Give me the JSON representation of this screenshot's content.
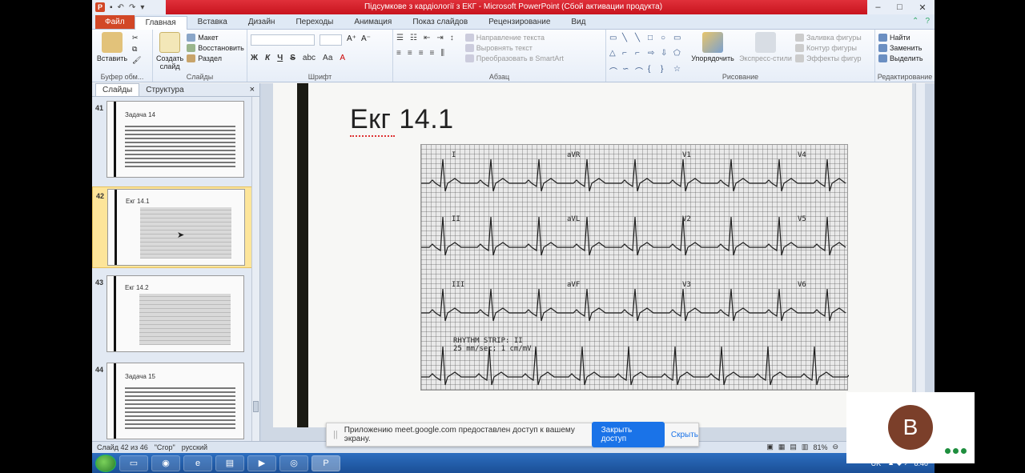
{
  "window": {
    "title": "Підсумкове з кардіології з ЕКГ  -  Microsoft PowerPoint (Сбой активации продукта)",
    "qa_icon": "P"
  },
  "tabs": [
    {
      "label": "Файл"
    },
    {
      "label": "Главная"
    },
    {
      "label": "Вставка"
    },
    {
      "label": "Дизайн"
    },
    {
      "label": "Переходы"
    },
    {
      "label": "Анимация"
    },
    {
      "label": "Показ слайдов"
    },
    {
      "label": "Рецензирование"
    },
    {
      "label": "Вид"
    }
  ],
  "ribbon": {
    "clipboard": {
      "paste": "Вставить",
      "label": "Буфер обм..."
    },
    "slides": {
      "new_slide": "Создать слайд",
      "layout": "Макет",
      "reset": "Восстановить",
      "section": "Раздел",
      "label": "Слайды"
    },
    "font": {
      "label": "Шрифт",
      "bold": "Ж",
      "italic": "К",
      "underline": "Ч",
      "strike": "S",
      "shadow": "abc",
      "aa": "Аа",
      "color": "А"
    },
    "paragraph": {
      "label": "Абзац",
      "text_dir": "Направление текста",
      "align_text": "Выровнять текст",
      "smartart": "Преобразовать в SmartArt"
    },
    "drawing": {
      "label": "Рисование",
      "arrange": "Упорядочить",
      "quick_styles": "Экспресс-стили",
      "fill": "Заливка фигуры",
      "outline": "Контур фигуры",
      "effects": "Эффекты фигур"
    },
    "editing": {
      "label": "Редактирование",
      "find": "Найти",
      "replace": "Заменить",
      "select": "Выделить"
    }
  },
  "panel": {
    "tab_slides": "Слайды",
    "tab_outline": "Структура",
    "close": "×",
    "thumbs": [
      {
        "num": "41",
        "title": "Задача 14",
        "kind": "text"
      },
      {
        "num": "42",
        "title": "Екг 14.1",
        "kind": "ecg",
        "selected": true
      },
      {
        "num": "43",
        "title": "Екг 14.2",
        "kind": "ecg"
      },
      {
        "num": "44",
        "title": "Задача 15",
        "kind": "text"
      }
    ]
  },
  "slide": {
    "heading": "Екг 14.1",
    "leads": [
      "I",
      "aVR",
      "V1",
      "V4",
      "II",
      "aVL",
      "V2",
      "V5",
      "III",
      "aVF",
      "V3",
      "V6"
    ],
    "strip_line1": "RHYTHM STRIP: II",
    "strip_line2": "25 mm/sec; 1 cm/mV"
  },
  "share_banner": {
    "grip": "||",
    "message": "Приложению meet.google.com предоставлен доступ к вашему экрану.",
    "stop": "Закрыть доступ",
    "hide": "Скрыть"
  },
  "status": {
    "slide_of": "Слайд 42 из 46",
    "theme": "\"Сгор\"",
    "language": "русский",
    "zoom": "81%"
  },
  "taskbar": {
    "lang": "UK",
    "time": "8:40"
  },
  "meet": {
    "avatar_letter": "В"
  },
  "colors": {
    "accent_red": "#c8141e",
    "file_tab": "#d24726",
    "meet_blue": "#1a73e8",
    "avatar": "#7b3f2a"
  }
}
